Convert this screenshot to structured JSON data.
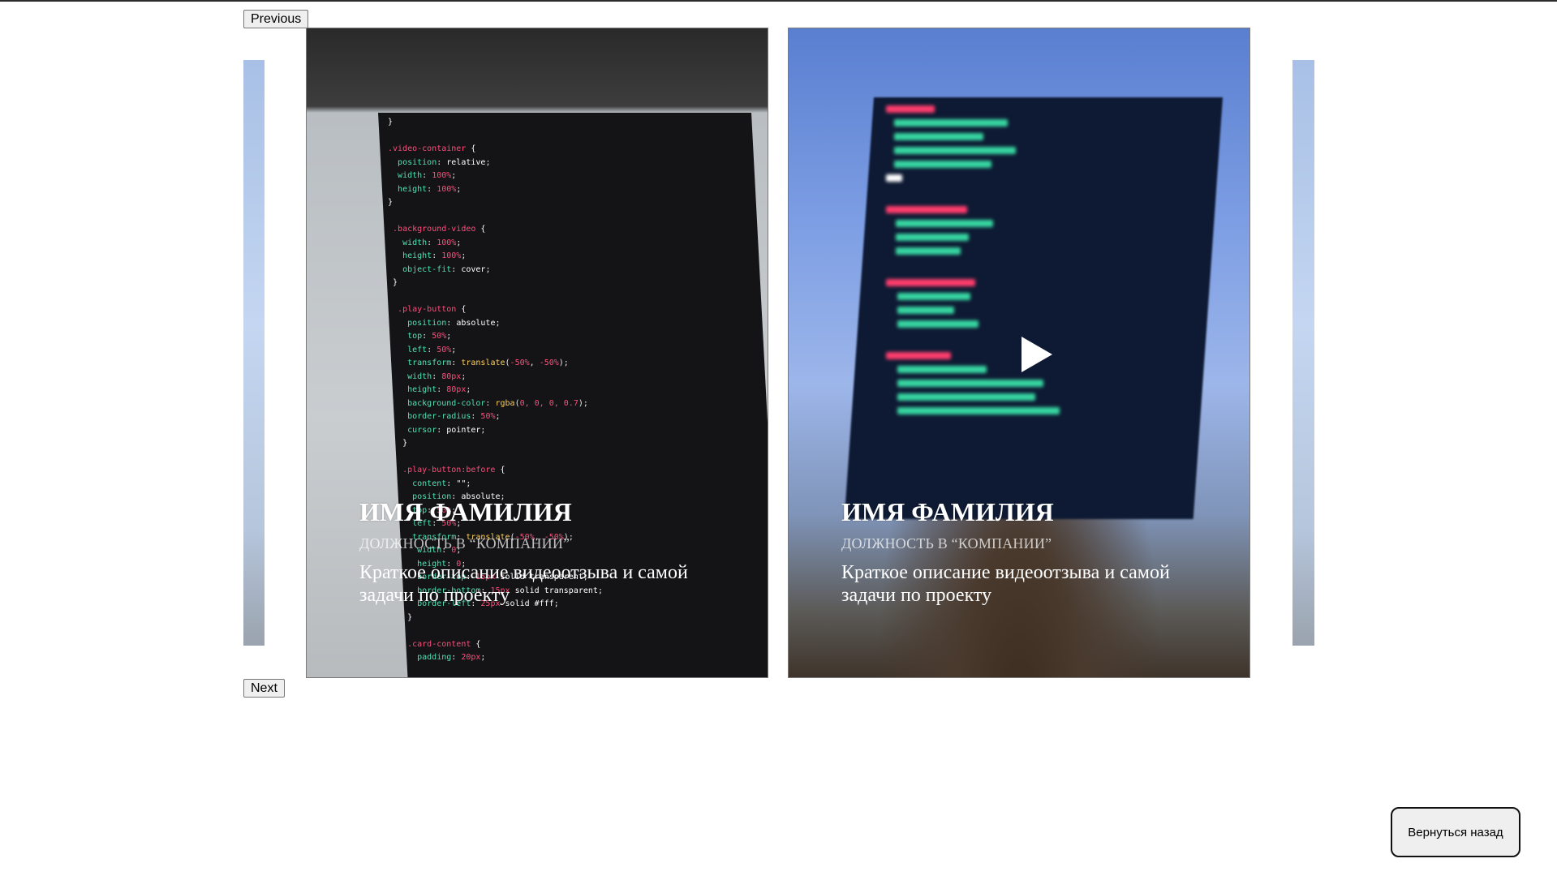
{
  "carousel": {
    "prev_label": "Previous",
    "next_label": "Next",
    "cards": [
      {
        "name": "ИМЯ ФАМИЛИЯ",
        "position": "ДОЛЖНОСТЬ В “КОМПАНИИ”",
        "description": "Краткое описание видеоотзыва и самой задачи по проекту"
      },
      {
        "name": "ИМЯ ФАМИЛИЯ",
        "position": "ДОЛЖНОСТЬ В “КОМПАНИИ”",
        "description": "Краткое описание видеоотзыва и самой задачи по проекту",
        "icon": "play-icon"
      }
    ]
  },
  "back_button_label": "Вернуться назад"
}
